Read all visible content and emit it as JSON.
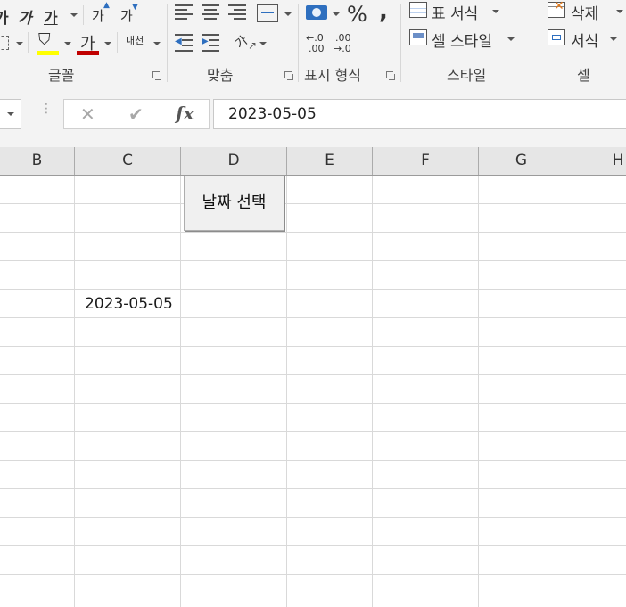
{
  "ribbon": {
    "font_group": {
      "label": "글꼴",
      "bold_glyph": "가",
      "italic_glyph": "가",
      "underline_glyph": "가",
      "grow_font_glyph": "가",
      "shrink_font_glyph": "가",
      "font_color_glyph": "가",
      "phonetic_glyph": "내천",
      "font_color": "#c00000",
      "fill_color": "#ffff00"
    },
    "align_group": {
      "label": "맞춤",
      "orientation_glyph": "가"
    },
    "number_group": {
      "label": "표시 형식",
      "percent": "%",
      "comma": ",",
      "inc_decimal_top": "←.0",
      "inc_decimal_bottom": ".00",
      "dec_decimal_top": ".00",
      "dec_decimal_bottom": "→.0"
    },
    "style_group": {
      "label": "스타일",
      "table_format": "표 서식",
      "cell_style": "셀 스타일"
    },
    "cells_group": {
      "label": "셀",
      "delete": "삭제",
      "format": "서식"
    }
  },
  "formula_bar": {
    "cancel_glyph": "✕",
    "enter_glyph": "✔",
    "fx_glyph": "fx",
    "value": "2023-05-05"
  },
  "grid": {
    "columns": [
      "B",
      "C",
      "D",
      "E",
      "F",
      "G",
      "H"
    ],
    "cell_c5": "2023-05-05"
  },
  "date_button": {
    "label": "날짜 선택"
  }
}
